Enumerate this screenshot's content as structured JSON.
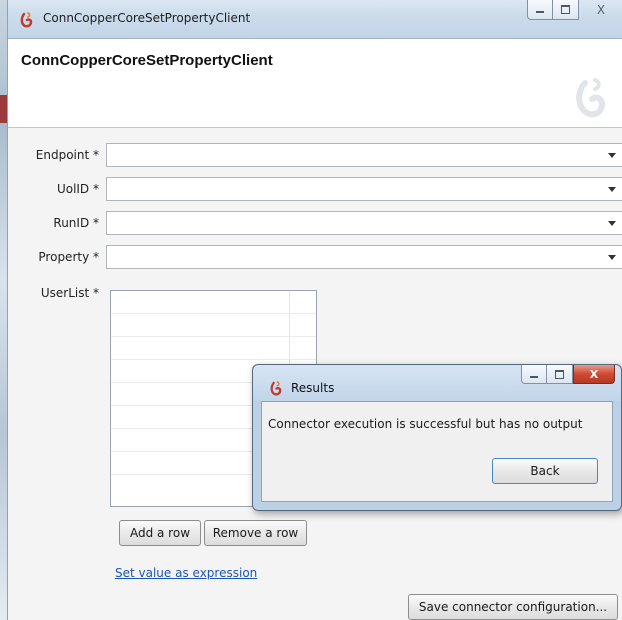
{
  "window": {
    "title": "ConnCopperCoreSetPropertyClient",
    "controls": [
      "minimize-icon",
      "maximize-icon",
      "close-icon"
    ]
  },
  "header": {
    "title": "ConnCopperCoreSetPropertyClient",
    "logo": "brand-logo-icon"
  },
  "form": {
    "fields": [
      {
        "label": "Endpoint *",
        "value": ""
      },
      {
        "label": "UolID *",
        "value": ""
      },
      {
        "label": "RunID *",
        "value": ""
      },
      {
        "label": "Property *",
        "value": ""
      }
    ],
    "userlist_label": "UserList *",
    "add_row_label": "Add a row",
    "remove_row_label": "Remove a row",
    "expression_link": "Set value as expression",
    "save_label": "Save connector configuration..."
  },
  "dialog": {
    "title": "Results",
    "message": "Connector execution is successful but has no output",
    "back_label": "Back",
    "close_glyph": "X"
  },
  "colors": {
    "brand": "#c0392b",
    "link": "#1a56b8",
    "close_button": "#c9452e"
  }
}
